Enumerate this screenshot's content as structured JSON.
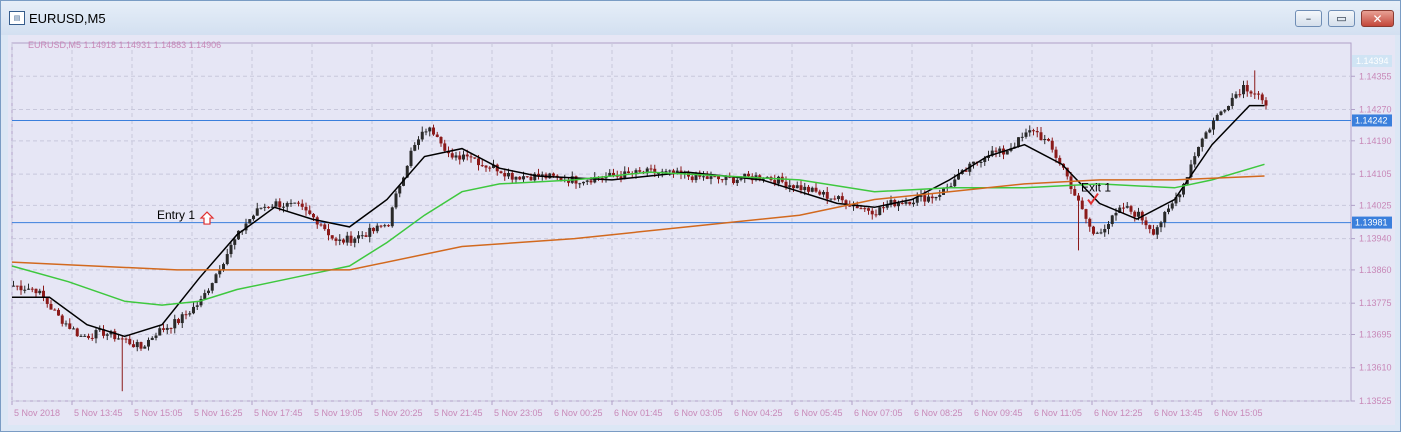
{
  "window": {
    "title": "EURUSD,M5",
    "controls": [
      "minimize",
      "maximize",
      "close"
    ]
  },
  "colors": {
    "background": "#e6e6f5",
    "bull_candle": "#2a2a2a",
    "bear_candle": "#8b1a1a",
    "grid": "#c8c8dc",
    "axis_text": "#c888b8",
    "hline": "#3a7fdc",
    "ma_black": "#000000",
    "ma_green": "#3ec83e",
    "ma_orange": "#d2691e",
    "entry_arrow": "#e03030",
    "exit_check": "#e03030"
  },
  "chart_data": {
    "type": "candlestick",
    "symbol_info": "EURUSD,M5  1.14918 1.14931 1.14883 1.14906",
    "ylim": [
      1.13525,
      1.1444
    ],
    "y_ticks": [
      "1.14355",
      "1.14270",
      "1.14190",
      "1.14105",
      "1.14025",
      "1.13940",
      "1.13860",
      "1.13775",
      "1.13695",
      "1.13610",
      "1.13525"
    ],
    "top_label": "1.14394",
    "x_ticks": [
      "5 Nov 2018",
      "5 Nov 13:45",
      "5 Nov 15:05",
      "5 Nov 16:25",
      "5 Nov 17:45",
      "5 Nov 19:05",
      "5 Nov 20:25",
      "5 Nov 21:45",
      "5 Nov 23:05",
      "6 Nov 00:25",
      "6 Nov 01:45",
      "6 Nov 03:05",
      "6 Nov 04:25",
      "6 Nov 05:45",
      "6 Nov 07:05",
      "6 Nov 08:25",
      "6 Nov 09:45",
      "6 Nov 11:05",
      "6 Nov 12:25",
      "6 Nov 13:45",
      "6 Nov 15:05"
    ],
    "candles_per_tick": 16,
    "horizontal_lines": [
      {
        "price": 1.14242,
        "label": "1.14242"
      },
      {
        "price": 1.13981,
        "label": "1.13981"
      }
    ],
    "close_path": [
      [
        0,
        1.1382
      ],
      [
        6,
        1.1381
      ],
      [
        12,
        1.1374
      ],
      [
        18,
        1.1369
      ],
      [
        24,
        1.137
      ],
      [
        30,
        1.1368
      ],
      [
        34,
        1.1366
      ],
      [
        38,
        1.137
      ],
      [
        44,
        1.1373
      ],
      [
        50,
        1.1378
      ],
      [
        54,
        1.1385
      ],
      [
        58,
        1.1392
      ],
      [
        62,
        1.1398
      ],
      [
        66,
        1.1402
      ],
      [
        70,
        1.1403
      ],
      [
        76,
        1.1402
      ],
      [
        82,
        1.1398
      ],
      [
        86,
        1.1393
      ],
      [
        90,
        1.1394
      ],
      [
        96,
        1.1396
      ],
      [
        100,
        1.1398
      ],
      [
        103,
        1.1408
      ],
      [
        106,
        1.1416
      ],
      [
        110,
        1.1422
      ],
      [
        113,
        1.1421
      ],
      [
        117,
        1.1414
      ],
      [
        121,
        1.1416
      ],
      [
        125,
        1.1413
      ],
      [
        129,
        1.1412
      ],
      [
        133,
        1.141
      ],
      [
        140,
        1.141
      ],
      [
        150,
        1.1409
      ],
      [
        160,
        1.141
      ],
      [
        170,
        1.1411
      ],
      [
        180,
        1.141
      ],
      [
        190,
        1.1409
      ],
      [
        200,
        1.141
      ],
      [
        210,
        1.1407
      ],
      [
        220,
        1.1404
      ],
      [
        226,
        1.1402
      ],
      [
        230,
        1.1401
      ],
      [
        234,
        1.1403
      ],
      [
        240,
        1.1404
      ],
      [
        246,
        1.1405
      ],
      [
        250,
        1.1408
      ],
      [
        256,
        1.1413
      ],
      [
        260,
        1.1416
      ],
      [
        264,
        1.1416
      ],
      [
        268,
        1.1419
      ],
      [
        272,
        1.1422
      ],
      [
        276,
        1.1418
      ],
      [
        280,
        1.1412
      ],
      [
        284,
        1.1403
      ],
      [
        288,
        1.1395
      ],
      [
        292,
        1.1398
      ],
      [
        296,
        1.1402
      ],
      [
        300,
        1.14
      ],
      [
        304,
        1.1396
      ],
      [
        308,
        1.1401
      ],
      [
        312,
        1.1408
      ],
      [
        316,
        1.1418
      ],
      [
        320,
        1.1424
      ],
      [
        324,
        1.1429
      ],
      [
        328,
        1.1433
      ],
      [
        332,
        1.1431
      ],
      [
        334,
        1.1427
      ]
    ],
    "spikes": [
      {
        "index": 29,
        "low": 1.1355
      },
      {
        "index": 284,
        "low": 1.1391
      },
      {
        "index": 331,
        "high": 1.1437
      }
    ],
    "moving_averages": [
      {
        "color": "#000000",
        "points": [
          [
            0,
            1.1379
          ],
          [
            10,
            1.1379
          ],
          [
            20,
            1.1372
          ],
          [
            30,
            1.1369
          ],
          [
            40,
            1.1372
          ],
          [
            50,
            1.1384
          ],
          [
            60,
            1.1395
          ],
          [
            70,
            1.1402
          ],
          [
            80,
            1.1399
          ],
          [
            90,
            1.1397
          ],
          [
            100,
            1.1404
          ],
          [
            110,
            1.1415
          ],
          [
            120,
            1.1417
          ],
          [
            130,
            1.1412
          ],
          [
            140,
            1.141
          ],
          [
            160,
            1.1409
          ],
          [
            180,
            1.1411
          ],
          [
            200,
            1.1409
          ],
          [
            220,
            1.1403
          ],
          [
            230,
            1.1402
          ],
          [
            240,
            1.1404
          ],
          [
            250,
            1.1409
          ],
          [
            260,
            1.1415
          ],
          [
            270,
            1.1418
          ],
          [
            280,
            1.1413
          ],
          [
            290,
            1.1403
          ],
          [
            300,
            1.1399
          ],
          [
            310,
            1.1404
          ],
          [
            320,
            1.1418
          ],
          [
            330,
            1.1428
          ],
          [
            334,
            1.1428
          ]
        ]
      },
      {
        "color": "#3ec83e",
        "points": [
          [
            0,
            1.1387
          ],
          [
            15,
            1.1383
          ],
          [
            30,
            1.1378
          ],
          [
            40,
            1.1377
          ],
          [
            50,
            1.1378
          ],
          [
            60,
            1.1381
          ],
          [
            70,
            1.1383
          ],
          [
            80,
            1.1385
          ],
          [
            90,
            1.1387
          ],
          [
            100,
            1.1393
          ],
          [
            110,
            1.14
          ],
          [
            120,
            1.1406
          ],
          [
            130,
            1.1408
          ],
          [
            150,
            1.1409
          ],
          [
            170,
            1.1411
          ],
          [
            190,
            1.141
          ],
          [
            210,
            1.1409
          ],
          [
            230,
            1.1406
          ],
          [
            250,
            1.1407
          ],
          [
            270,
            1.1407
          ],
          [
            290,
            1.1408
          ],
          [
            310,
            1.1407
          ],
          [
            320,
            1.1409
          ],
          [
            334,
            1.1413
          ]
        ]
      },
      {
        "color": "#d2691e",
        "points": [
          [
            0,
            1.1388
          ],
          [
            44,
            1.1386
          ],
          [
            60,
            1.1386
          ],
          [
            90,
            1.1386
          ],
          [
            120,
            1.1392
          ],
          [
            150,
            1.1394
          ],
          [
            180,
            1.1397
          ],
          [
            210,
            1.14
          ],
          [
            230,
            1.1404
          ],
          [
            250,
            1.1406
          ],
          [
            270,
            1.1408
          ],
          [
            290,
            1.1409
          ],
          [
            310,
            1.1409
          ],
          [
            334,
            1.141
          ]
        ]
      }
    ],
    "annotations": [
      {
        "text": "Entry 1",
        "index": 52,
        "price": 1.1399,
        "symbol": "up-arrow"
      },
      {
        "text": "Exit 1",
        "index": 288,
        "price": 1.1405,
        "symbol": "check"
      }
    ]
  }
}
